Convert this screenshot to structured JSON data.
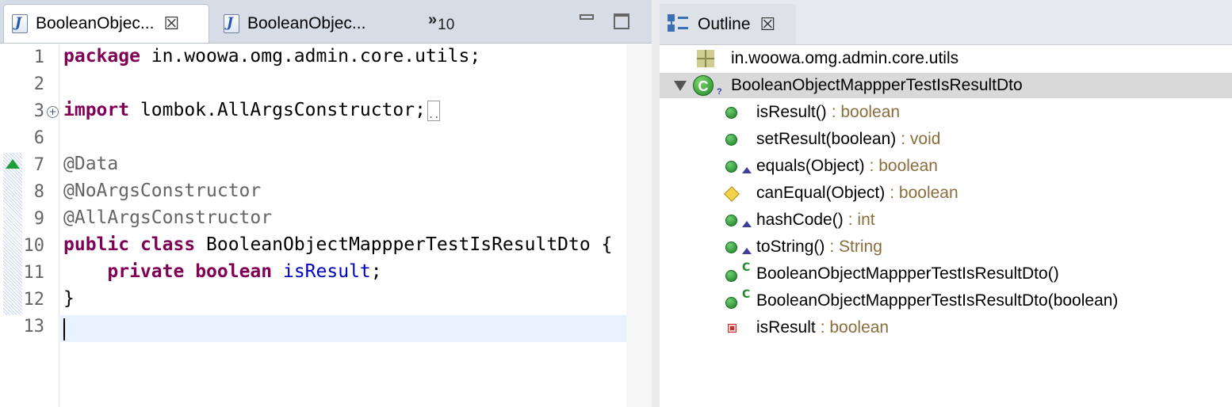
{
  "editor": {
    "tabs": [
      {
        "label": "BooleanObjec...",
        "active": true
      },
      {
        "label": "BooleanObjec...",
        "active": false
      }
    ],
    "overflow_count": "10",
    "line_numbers": [
      "1",
      "2",
      "3",
      "6",
      "7",
      "8",
      "9",
      "10",
      "11",
      "12",
      "13"
    ],
    "code": {
      "pkg_kw": "package",
      "pkg_name": " in.woowa.omg.admin.core.utils;",
      "imp_kw": "import",
      "imp_name": " lombok.AllArgsConstructor;",
      "ann_data": "@Data",
      "ann_noargs": "@NoArgsConstructor",
      "ann_allargs": "@AllArgsConstructor",
      "public_kw": "public",
      "class_kw": "class",
      "class_decl": " BooleanObjectMappperTestIsResultDto {",
      "private_kw": "private",
      "boolean_kw": "boolean",
      "field_name": "isResult",
      "semicolon": ";",
      "close_brace": "}"
    }
  },
  "outline": {
    "tab_label": "Outline",
    "package": "in.woowa.omg.admin.core.utils",
    "class_name": "BooleanObjectMappperTestIsResultDto",
    "members": [
      {
        "name": "isResult()",
        "type": ": boolean"
      },
      {
        "name": "setResult(boolean)",
        "type": ": void"
      },
      {
        "name": "equals(Object)",
        "type": ": boolean"
      },
      {
        "name": "canEqual(Object)",
        "type": ": boolean"
      },
      {
        "name": "hashCode()",
        "type": ": int"
      },
      {
        "name": "toString()",
        "type": ": String"
      },
      {
        "name": "BooleanObjectMappperTestIsResultDto()",
        "type": ""
      },
      {
        "name": "BooleanObjectMappperTestIsResultDto(boolean)",
        "type": ""
      },
      {
        "name": "isResult",
        "type": ": boolean"
      }
    ]
  },
  "colors": {
    "keyword": "#7f0055",
    "annotation": "#646464",
    "field": "#0000c0",
    "type_hint": "#8a6d3b",
    "current_line": "#e8f2fe",
    "selection": "#d9d9d9"
  }
}
